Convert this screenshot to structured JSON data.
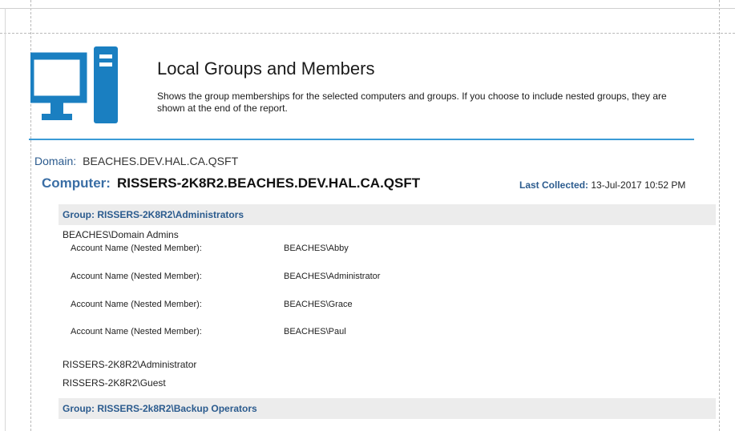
{
  "report": {
    "title": "Local Groups and Members",
    "description": "Shows the group memberships for the selected computers and groups. If you choose to include nested groups, they are shown at the end of the report."
  },
  "domain": {
    "label": "Domain:",
    "value": "BEACHES.DEV.HAL.CA.QSFT"
  },
  "computer": {
    "label": "Computer:",
    "value": "RISSERS-2K8R2.BEACHES.DEV.HAL.CA.QSFT",
    "last_collected_label": "Last Collected:",
    "last_collected_value": "13-Jul-2017 10:52 PM"
  },
  "groups": [
    {
      "label": "Group:  RISSERS-2K8R2\\Administrators",
      "members": [
        {
          "name": "BEACHES\\Domain Admins",
          "nested": [
            {
              "label": "Account Name (Nested Member):",
              "value": "BEACHES\\Abby"
            },
            {
              "label": "Account Name (Nested Member):",
              "value": "BEACHES\\Administrator"
            },
            {
              "label": "Account Name (Nested Member):",
              "value": "BEACHES\\Grace"
            },
            {
              "label": "Account Name (Nested Member):",
              "value": "BEACHES\\Paul"
            }
          ]
        },
        {
          "name": "RISSERS-2K8R2\\Administrator"
        },
        {
          "name": "RISSERS-2K8R2\\Guest"
        }
      ]
    },
    {
      "label": "Group:  RISSERS-2k8R2\\Backup Operators"
    }
  ],
  "colors": {
    "accent": "#1a7fc1",
    "rule": "#3a9bd6",
    "group_bg": "#ececec",
    "link_text": "#2b5b8e"
  },
  "icons": {
    "logo": "desktop-computer-icon"
  }
}
